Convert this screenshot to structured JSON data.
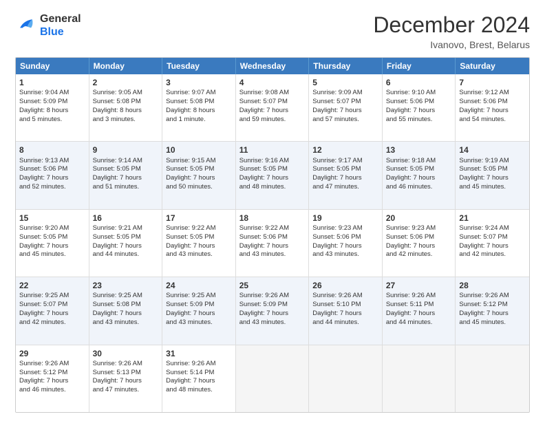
{
  "logo": {
    "line1": "General",
    "line2": "Blue"
  },
  "title": "December 2024",
  "location": "Ivanovo, Brest, Belarus",
  "days_header": [
    "Sunday",
    "Monday",
    "Tuesday",
    "Wednesday",
    "Thursday",
    "Friday",
    "Saturday"
  ],
  "weeks": [
    [
      {
        "day": "1",
        "lines": [
          "Sunrise: 9:04 AM",
          "Sunset: 5:09 PM",
          "Daylight: 8 hours",
          "and 5 minutes."
        ]
      },
      {
        "day": "2",
        "lines": [
          "Sunrise: 9:05 AM",
          "Sunset: 5:08 PM",
          "Daylight: 8 hours",
          "and 3 minutes."
        ]
      },
      {
        "day": "3",
        "lines": [
          "Sunrise: 9:07 AM",
          "Sunset: 5:08 PM",
          "Daylight: 8 hours",
          "and 1 minute."
        ]
      },
      {
        "day": "4",
        "lines": [
          "Sunrise: 9:08 AM",
          "Sunset: 5:07 PM",
          "Daylight: 7 hours",
          "and 59 minutes."
        ]
      },
      {
        "day": "5",
        "lines": [
          "Sunrise: 9:09 AM",
          "Sunset: 5:07 PM",
          "Daylight: 7 hours",
          "and 57 minutes."
        ]
      },
      {
        "day": "6",
        "lines": [
          "Sunrise: 9:10 AM",
          "Sunset: 5:06 PM",
          "Daylight: 7 hours",
          "and 55 minutes."
        ]
      },
      {
        "day": "7",
        "lines": [
          "Sunrise: 9:12 AM",
          "Sunset: 5:06 PM",
          "Daylight: 7 hours",
          "and 54 minutes."
        ]
      }
    ],
    [
      {
        "day": "8",
        "lines": [
          "Sunrise: 9:13 AM",
          "Sunset: 5:06 PM",
          "Daylight: 7 hours",
          "and 52 minutes."
        ]
      },
      {
        "day": "9",
        "lines": [
          "Sunrise: 9:14 AM",
          "Sunset: 5:05 PM",
          "Daylight: 7 hours",
          "and 51 minutes."
        ]
      },
      {
        "day": "10",
        "lines": [
          "Sunrise: 9:15 AM",
          "Sunset: 5:05 PM",
          "Daylight: 7 hours",
          "and 50 minutes."
        ]
      },
      {
        "day": "11",
        "lines": [
          "Sunrise: 9:16 AM",
          "Sunset: 5:05 PM",
          "Daylight: 7 hours",
          "and 48 minutes."
        ]
      },
      {
        "day": "12",
        "lines": [
          "Sunrise: 9:17 AM",
          "Sunset: 5:05 PM",
          "Daylight: 7 hours",
          "and 47 minutes."
        ]
      },
      {
        "day": "13",
        "lines": [
          "Sunrise: 9:18 AM",
          "Sunset: 5:05 PM",
          "Daylight: 7 hours",
          "and 46 minutes."
        ]
      },
      {
        "day": "14",
        "lines": [
          "Sunrise: 9:19 AM",
          "Sunset: 5:05 PM",
          "Daylight: 7 hours",
          "and 45 minutes."
        ]
      }
    ],
    [
      {
        "day": "15",
        "lines": [
          "Sunrise: 9:20 AM",
          "Sunset: 5:05 PM",
          "Daylight: 7 hours",
          "and 45 minutes."
        ]
      },
      {
        "day": "16",
        "lines": [
          "Sunrise: 9:21 AM",
          "Sunset: 5:05 PM",
          "Daylight: 7 hours",
          "and 44 minutes."
        ]
      },
      {
        "day": "17",
        "lines": [
          "Sunrise: 9:22 AM",
          "Sunset: 5:05 PM",
          "Daylight: 7 hours",
          "and 43 minutes."
        ]
      },
      {
        "day": "18",
        "lines": [
          "Sunrise: 9:22 AM",
          "Sunset: 5:06 PM",
          "Daylight: 7 hours",
          "and 43 minutes."
        ]
      },
      {
        "day": "19",
        "lines": [
          "Sunrise: 9:23 AM",
          "Sunset: 5:06 PM",
          "Daylight: 7 hours",
          "and 43 minutes."
        ]
      },
      {
        "day": "20",
        "lines": [
          "Sunrise: 9:23 AM",
          "Sunset: 5:06 PM",
          "Daylight: 7 hours",
          "and 42 minutes."
        ]
      },
      {
        "day": "21",
        "lines": [
          "Sunrise: 9:24 AM",
          "Sunset: 5:07 PM",
          "Daylight: 7 hours",
          "and 42 minutes."
        ]
      }
    ],
    [
      {
        "day": "22",
        "lines": [
          "Sunrise: 9:25 AM",
          "Sunset: 5:07 PM",
          "Daylight: 7 hours",
          "and 42 minutes."
        ]
      },
      {
        "day": "23",
        "lines": [
          "Sunrise: 9:25 AM",
          "Sunset: 5:08 PM",
          "Daylight: 7 hours",
          "and 43 minutes."
        ]
      },
      {
        "day": "24",
        "lines": [
          "Sunrise: 9:25 AM",
          "Sunset: 5:09 PM",
          "Daylight: 7 hours",
          "and 43 minutes."
        ]
      },
      {
        "day": "25",
        "lines": [
          "Sunrise: 9:26 AM",
          "Sunset: 5:09 PM",
          "Daylight: 7 hours",
          "and 43 minutes."
        ]
      },
      {
        "day": "26",
        "lines": [
          "Sunrise: 9:26 AM",
          "Sunset: 5:10 PM",
          "Daylight: 7 hours",
          "and 44 minutes."
        ]
      },
      {
        "day": "27",
        "lines": [
          "Sunrise: 9:26 AM",
          "Sunset: 5:11 PM",
          "Daylight: 7 hours",
          "and 44 minutes."
        ]
      },
      {
        "day": "28",
        "lines": [
          "Sunrise: 9:26 AM",
          "Sunset: 5:12 PM",
          "Daylight: 7 hours",
          "and 45 minutes."
        ]
      }
    ],
    [
      {
        "day": "29",
        "lines": [
          "Sunrise: 9:26 AM",
          "Sunset: 5:12 PM",
          "Daylight: 7 hours",
          "and 46 minutes."
        ]
      },
      {
        "day": "30",
        "lines": [
          "Sunrise: 9:26 AM",
          "Sunset: 5:13 PM",
          "Daylight: 7 hours",
          "and 47 minutes."
        ]
      },
      {
        "day": "31",
        "lines": [
          "Sunrise: 9:26 AM",
          "Sunset: 5:14 PM",
          "Daylight: 7 hours",
          "and 48 minutes."
        ]
      },
      {
        "day": "",
        "lines": []
      },
      {
        "day": "",
        "lines": []
      },
      {
        "day": "",
        "lines": []
      },
      {
        "day": "",
        "lines": []
      }
    ]
  ]
}
